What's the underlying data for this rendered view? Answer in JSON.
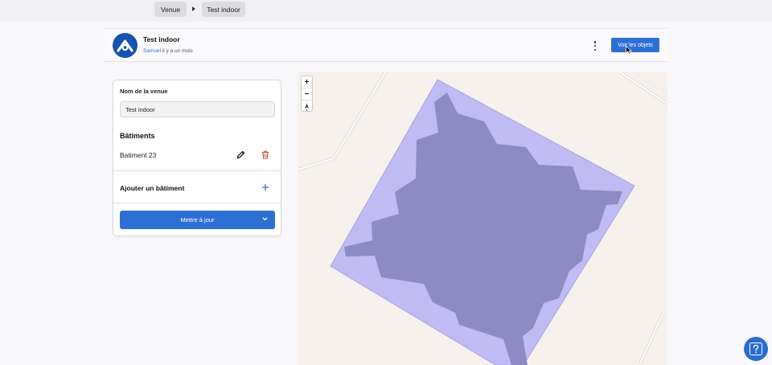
{
  "breadcrumb": {
    "venue": "Venue",
    "current": "Test indoor"
  },
  "header": {
    "title": "Test indoor",
    "author": "Samuel",
    "time": "il y a un mois",
    "view_objects_label": "Voir les objets"
  },
  "panel": {
    "venue_name_label": "Nom de la venue",
    "venue_name_value": "Test indoor",
    "buildings_title": "Bâtiments",
    "buildings": [
      {
        "name": "Batiment 23"
      }
    ],
    "add_building_label": "Ajouter un bâtiment",
    "update_label": "Mettre à jour"
  },
  "map": {
    "zoom_in": "+",
    "zoom_out": "−",
    "outer_color": "#c0bbf2",
    "inner_color": "#8e8bc4"
  },
  "colors": {
    "accent": "#2e6fd4",
    "map_bg": "#f6f1ec"
  }
}
